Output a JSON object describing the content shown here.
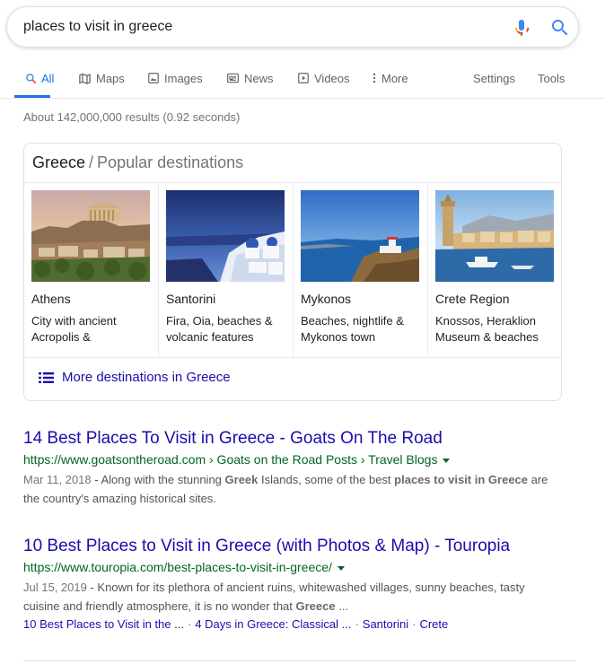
{
  "search": {
    "query": "places to visit in greece"
  },
  "tabs": [
    {
      "label": "All",
      "icon": "search-icon"
    },
    {
      "label": "Maps",
      "icon": "map-icon"
    },
    {
      "label": "Images",
      "icon": "image-icon"
    },
    {
      "label": "News",
      "icon": "news-icon"
    },
    {
      "label": "Videos",
      "icon": "video-icon"
    },
    {
      "label": "More",
      "icon": "more-vert-icon"
    },
    {
      "label": "Settings"
    },
    {
      "label": "Tools"
    }
  ],
  "result_stats": "About 142,000,000 results (0.92 seconds)",
  "card": {
    "title": "Greece",
    "separator": "/",
    "subtitle": "Popular destinations",
    "destinations": [
      {
        "name": "Athens",
        "desc_1": "City with ancient",
        "desc_2": "Acropolis &"
      },
      {
        "name": "Santorini",
        "desc_1": "Fira, Oia, beaches &",
        "desc_2": "volcanic features"
      },
      {
        "name": "Mykonos",
        "desc_1": "Beaches, nightlife &",
        "desc_2": "Mykonos town"
      },
      {
        "name": "Crete Region",
        "desc_1": "Knossos, Heraklion",
        "desc_2": "Museum & beaches"
      }
    ],
    "more_label": "More destinations in Greece"
  },
  "results": [
    {
      "title": "14 Best Places To Visit in Greece - Goats On The Road",
      "url": "https://www.goatsontheroad.com › Goats on the Road Posts › Travel Blogs",
      "date": "Mar 11, 2018",
      "dash": " - ",
      "s1": "Along with the stunning ",
      "b1": "Greek",
      "s2": " Islands, some of the best ",
      "b2": "places to visit in Greece",
      "s3": " are the country's amazing historical sites."
    },
    {
      "title": "10 Best Places to Visit in Greece (with Photos & Map) - Touropia",
      "url": "https://www.touropia.com/best-places-to-visit-in-greece/",
      "date": "Jul 15, 2019",
      "dash": " - ",
      "s1": "Known for its plethora of ancient ruins, whitewashed villages, sunny beaches, tasty cuisine and friendly atmosphere, it is no wonder that ",
      "b1": "Greece",
      "s2": " ...",
      "sitelinks": [
        "10 Best Places to Visit in the ...",
        "4 Days in Greece: Classical ...",
        "Santorini",
        "Crete"
      ],
      "sitelink_sep": "·"
    }
  ],
  "colors": {
    "link": "#1a0dab",
    "url_green": "#006621",
    "accent_blue": "#1a73e8",
    "mic_red": "#ea4335",
    "mic_yellow": "#fbbc04",
    "mic_green": "#34a853",
    "mic_blue": "#4285f4"
  }
}
